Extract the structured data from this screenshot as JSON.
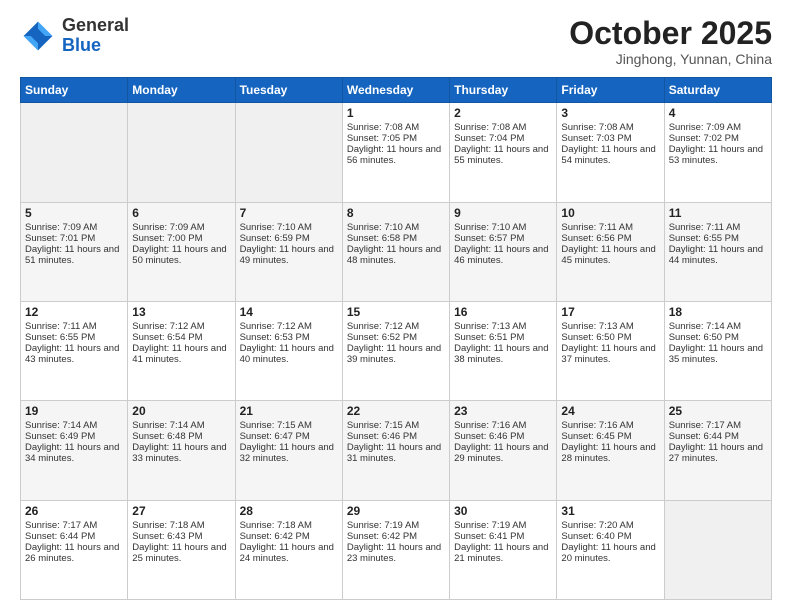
{
  "header": {
    "logo_general": "General",
    "logo_blue": "Blue",
    "month_title": "October 2025",
    "location": "Jinghong, Yunnan, China"
  },
  "days_of_week": [
    "Sunday",
    "Monday",
    "Tuesday",
    "Wednesday",
    "Thursday",
    "Friday",
    "Saturday"
  ],
  "weeks": [
    [
      {
        "day": "",
        "sunrise": "",
        "sunset": "",
        "daylight": ""
      },
      {
        "day": "",
        "sunrise": "",
        "sunset": "",
        "daylight": ""
      },
      {
        "day": "",
        "sunrise": "",
        "sunset": "",
        "daylight": ""
      },
      {
        "day": "1",
        "sunrise": "Sunrise: 7:08 AM",
        "sunset": "Sunset: 7:05 PM",
        "daylight": "Daylight: 11 hours and 56 minutes."
      },
      {
        "day": "2",
        "sunrise": "Sunrise: 7:08 AM",
        "sunset": "Sunset: 7:04 PM",
        "daylight": "Daylight: 11 hours and 55 minutes."
      },
      {
        "day": "3",
        "sunrise": "Sunrise: 7:08 AM",
        "sunset": "Sunset: 7:03 PM",
        "daylight": "Daylight: 11 hours and 54 minutes."
      },
      {
        "day": "4",
        "sunrise": "Sunrise: 7:09 AM",
        "sunset": "Sunset: 7:02 PM",
        "daylight": "Daylight: 11 hours and 53 minutes."
      }
    ],
    [
      {
        "day": "5",
        "sunrise": "Sunrise: 7:09 AM",
        "sunset": "Sunset: 7:01 PM",
        "daylight": "Daylight: 11 hours and 51 minutes."
      },
      {
        "day": "6",
        "sunrise": "Sunrise: 7:09 AM",
        "sunset": "Sunset: 7:00 PM",
        "daylight": "Daylight: 11 hours and 50 minutes."
      },
      {
        "day": "7",
        "sunrise": "Sunrise: 7:10 AM",
        "sunset": "Sunset: 6:59 PM",
        "daylight": "Daylight: 11 hours and 49 minutes."
      },
      {
        "day": "8",
        "sunrise": "Sunrise: 7:10 AM",
        "sunset": "Sunset: 6:58 PM",
        "daylight": "Daylight: 11 hours and 48 minutes."
      },
      {
        "day": "9",
        "sunrise": "Sunrise: 7:10 AM",
        "sunset": "Sunset: 6:57 PM",
        "daylight": "Daylight: 11 hours and 46 minutes."
      },
      {
        "day": "10",
        "sunrise": "Sunrise: 7:11 AM",
        "sunset": "Sunset: 6:56 PM",
        "daylight": "Daylight: 11 hours and 45 minutes."
      },
      {
        "day": "11",
        "sunrise": "Sunrise: 7:11 AM",
        "sunset": "Sunset: 6:55 PM",
        "daylight": "Daylight: 11 hours and 44 minutes."
      }
    ],
    [
      {
        "day": "12",
        "sunrise": "Sunrise: 7:11 AM",
        "sunset": "Sunset: 6:55 PM",
        "daylight": "Daylight: 11 hours and 43 minutes."
      },
      {
        "day": "13",
        "sunrise": "Sunrise: 7:12 AM",
        "sunset": "Sunset: 6:54 PM",
        "daylight": "Daylight: 11 hours and 41 minutes."
      },
      {
        "day": "14",
        "sunrise": "Sunrise: 7:12 AM",
        "sunset": "Sunset: 6:53 PM",
        "daylight": "Daylight: 11 hours and 40 minutes."
      },
      {
        "day": "15",
        "sunrise": "Sunrise: 7:12 AM",
        "sunset": "Sunset: 6:52 PM",
        "daylight": "Daylight: 11 hours and 39 minutes."
      },
      {
        "day": "16",
        "sunrise": "Sunrise: 7:13 AM",
        "sunset": "Sunset: 6:51 PM",
        "daylight": "Daylight: 11 hours and 38 minutes."
      },
      {
        "day": "17",
        "sunrise": "Sunrise: 7:13 AM",
        "sunset": "Sunset: 6:50 PM",
        "daylight": "Daylight: 11 hours and 37 minutes."
      },
      {
        "day": "18",
        "sunrise": "Sunrise: 7:14 AM",
        "sunset": "Sunset: 6:50 PM",
        "daylight": "Daylight: 11 hours and 35 minutes."
      }
    ],
    [
      {
        "day": "19",
        "sunrise": "Sunrise: 7:14 AM",
        "sunset": "Sunset: 6:49 PM",
        "daylight": "Daylight: 11 hours and 34 minutes."
      },
      {
        "day": "20",
        "sunrise": "Sunrise: 7:14 AM",
        "sunset": "Sunset: 6:48 PM",
        "daylight": "Daylight: 11 hours and 33 minutes."
      },
      {
        "day": "21",
        "sunrise": "Sunrise: 7:15 AM",
        "sunset": "Sunset: 6:47 PM",
        "daylight": "Daylight: 11 hours and 32 minutes."
      },
      {
        "day": "22",
        "sunrise": "Sunrise: 7:15 AM",
        "sunset": "Sunset: 6:46 PM",
        "daylight": "Daylight: 11 hours and 31 minutes."
      },
      {
        "day": "23",
        "sunrise": "Sunrise: 7:16 AM",
        "sunset": "Sunset: 6:46 PM",
        "daylight": "Daylight: 11 hours and 29 minutes."
      },
      {
        "day": "24",
        "sunrise": "Sunrise: 7:16 AM",
        "sunset": "Sunset: 6:45 PM",
        "daylight": "Daylight: 11 hours and 28 minutes."
      },
      {
        "day": "25",
        "sunrise": "Sunrise: 7:17 AM",
        "sunset": "Sunset: 6:44 PM",
        "daylight": "Daylight: 11 hours and 27 minutes."
      }
    ],
    [
      {
        "day": "26",
        "sunrise": "Sunrise: 7:17 AM",
        "sunset": "Sunset: 6:44 PM",
        "daylight": "Daylight: 11 hours and 26 minutes."
      },
      {
        "day": "27",
        "sunrise": "Sunrise: 7:18 AM",
        "sunset": "Sunset: 6:43 PM",
        "daylight": "Daylight: 11 hours and 25 minutes."
      },
      {
        "day": "28",
        "sunrise": "Sunrise: 7:18 AM",
        "sunset": "Sunset: 6:42 PM",
        "daylight": "Daylight: 11 hours and 24 minutes."
      },
      {
        "day": "29",
        "sunrise": "Sunrise: 7:19 AM",
        "sunset": "Sunset: 6:42 PM",
        "daylight": "Daylight: 11 hours and 23 minutes."
      },
      {
        "day": "30",
        "sunrise": "Sunrise: 7:19 AM",
        "sunset": "Sunset: 6:41 PM",
        "daylight": "Daylight: 11 hours and 21 minutes."
      },
      {
        "day": "31",
        "sunrise": "Sunrise: 7:20 AM",
        "sunset": "Sunset: 6:40 PM",
        "daylight": "Daylight: 11 hours and 20 minutes."
      },
      {
        "day": "",
        "sunrise": "",
        "sunset": "",
        "daylight": ""
      }
    ]
  ]
}
